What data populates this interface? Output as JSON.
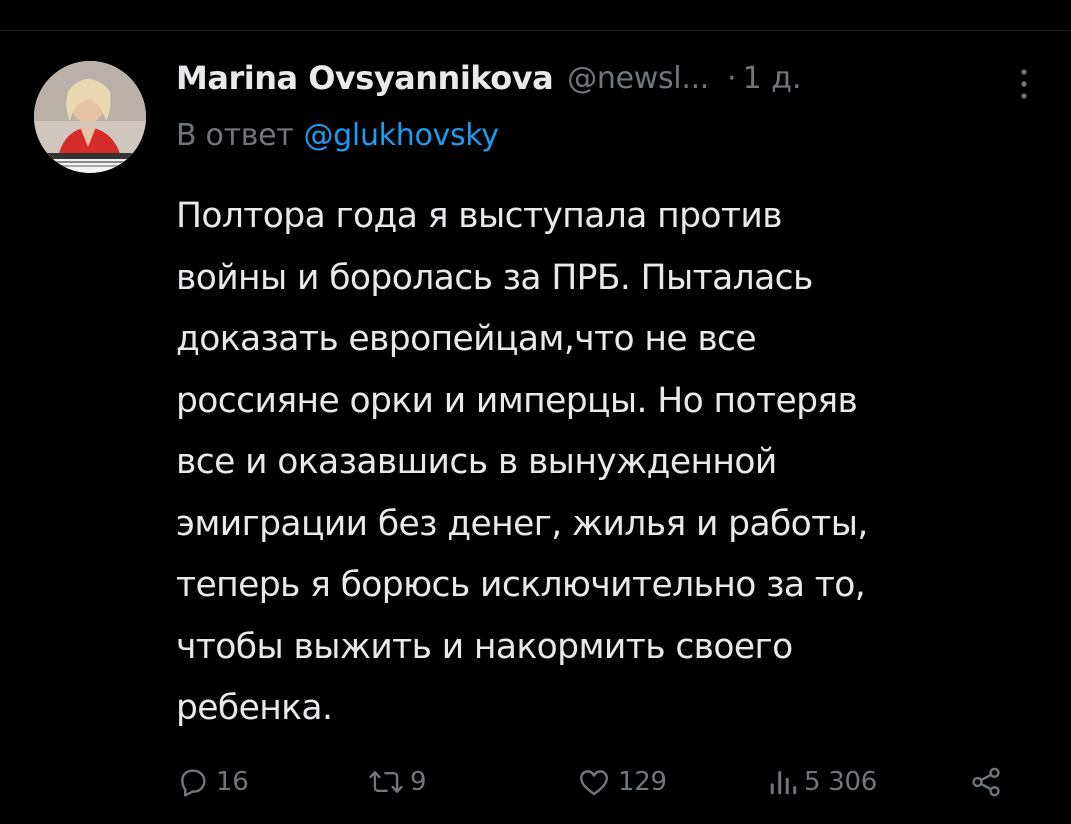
{
  "author": {
    "name": "Marina Ovsyannikova",
    "handle": "@newsl...",
    "separator": "·",
    "time": "1 д."
  },
  "reply": {
    "prefix": "В ответ",
    "mention": "@glukhovsky"
  },
  "tweet": {
    "lines": [
      "Полтора года я выступала против",
      "войны и боролась за ПРБ. Пыталась",
      "доказать европейцам,что не все",
      "россияне орки и имперцы. Но потеряв",
      "все и оказавшись в вынужденной",
      "эмиграции без денег, жилья и работы,",
      "теперь я борюсь исключительно за то,",
      "чтобы выжить и накормить своего",
      "ребенка."
    ]
  },
  "actions": {
    "replies": "16",
    "reposts": "9",
    "likes": "129",
    "views": "5 306"
  },
  "colors": {
    "background": "#000000",
    "text": "#e7e9ea",
    "secondary": "#71767b",
    "link": "#1d9bf0"
  },
  "icons": [
    "more-icon",
    "reply-icon",
    "repost-icon",
    "like-icon",
    "views-icon",
    "share-icon"
  ]
}
